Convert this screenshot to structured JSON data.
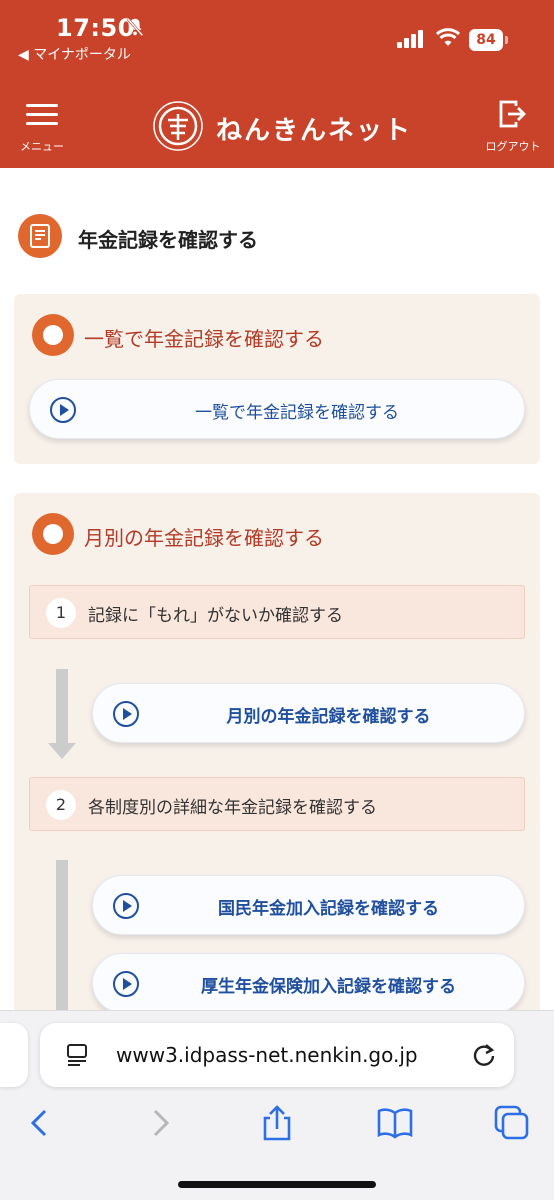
{
  "status_bar": {
    "time": "17:50",
    "back_app": "◀ マイナポータル",
    "battery": "84",
    "icons": [
      "bell-slash-icon",
      "signal-icon",
      "wifi-icon",
      "battery-icon"
    ]
  },
  "header": {
    "menu_label": "メニュー",
    "site_name": "ねんきんネット",
    "logout_label": "ログアウト",
    "brand_color": "#c9432a"
  },
  "page": {
    "title": "年金記録を確認する"
  },
  "section1": {
    "title": "一覧で年金記録を確認する",
    "button": "一覧で年金記録を確認する"
  },
  "section2": {
    "title": "月別の年金記録を確認する",
    "steps": [
      {
        "num": "1",
        "text": "記録に「もれ」がないか確認する",
        "buttons": [
          "月別の年金記録を確認する"
        ]
      },
      {
        "num": "2",
        "text": "各制度別の詳細な年金記録を確認する",
        "buttons": [
          "国民年金加入記録を確認する",
          "厚生年金保険加入記録を確認する"
        ]
      }
    ]
  },
  "browser": {
    "url": "www3.idpass-net.nenkin.go.jp",
    "toolbar": [
      "back-icon",
      "forward-icon",
      "share-icon",
      "bookmarks-icon",
      "tabs-icon"
    ]
  },
  "colors": {
    "accent": "#e0682f",
    "link": "#1f4f9e",
    "section_bg": "#f8f1ea",
    "step_bg": "#f9e6dc"
  }
}
